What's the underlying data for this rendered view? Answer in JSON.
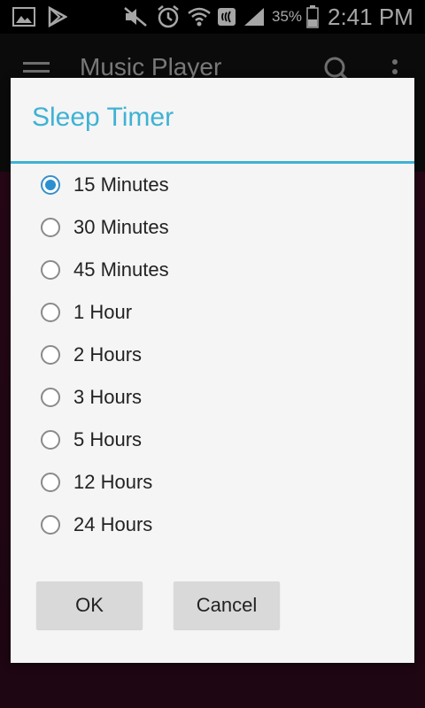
{
  "status_bar": {
    "battery_percent": "35%",
    "time": "2:41 PM",
    "icons": [
      "image-icon",
      "play-store-icon",
      "mute-icon",
      "alarm-icon",
      "wifi-icon",
      "nfc-icon",
      "signal-icon",
      "battery-icon"
    ]
  },
  "background_app": {
    "title": "Music Player"
  },
  "dialog": {
    "title": "Sleep Timer",
    "accent_color": "#3fb2d4",
    "options": [
      {
        "label": "15 Minutes",
        "checked": true
      },
      {
        "label": "30 Minutes",
        "checked": false
      },
      {
        "label": "45 Minutes",
        "checked": false
      },
      {
        "label": "1 Hour",
        "checked": false
      },
      {
        "label": "2 Hours",
        "checked": false
      },
      {
        "label": "3 Hours",
        "checked": false
      },
      {
        "label": "5 Hours",
        "checked": false
      },
      {
        "label": "12 Hours",
        "checked": false
      },
      {
        "label": "24 Hours",
        "checked": false
      }
    ],
    "ok_label": "OK",
    "cancel_label": "Cancel"
  }
}
